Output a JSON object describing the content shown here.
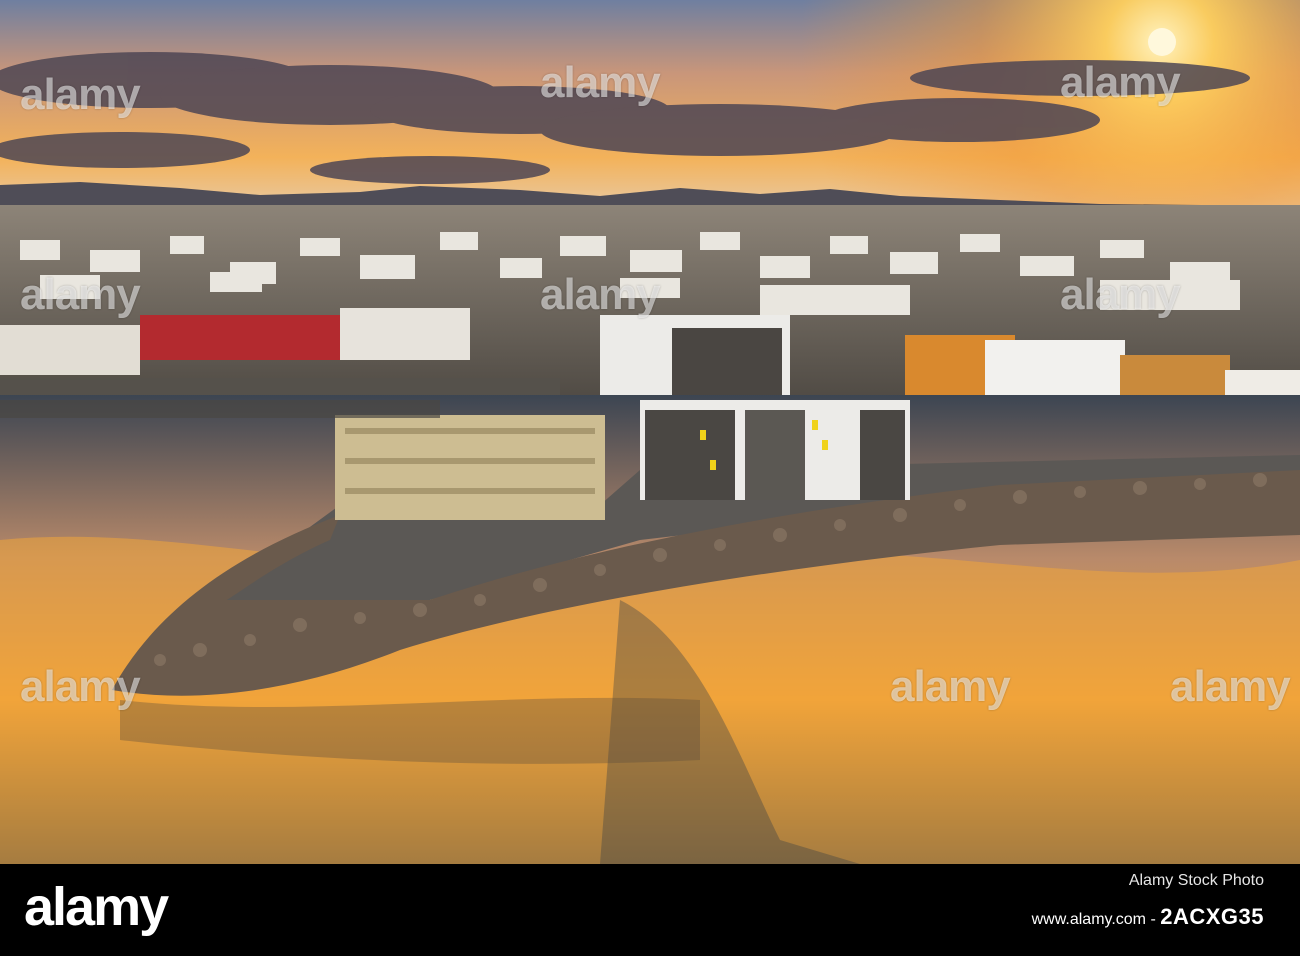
{
  "watermark": {
    "text": "alamy"
  },
  "footer": {
    "logo": "alamy",
    "line1": "Alamy Stock Photo",
    "line2_prefix": "www.alamy.com - ",
    "image_id": "2ACXG35"
  },
  "colors": {
    "sky_top": "#6f7fa0",
    "sun": "#ffd36a",
    "water_gold": "#f0a53a",
    "breakwater": "#6a5a4c"
  }
}
